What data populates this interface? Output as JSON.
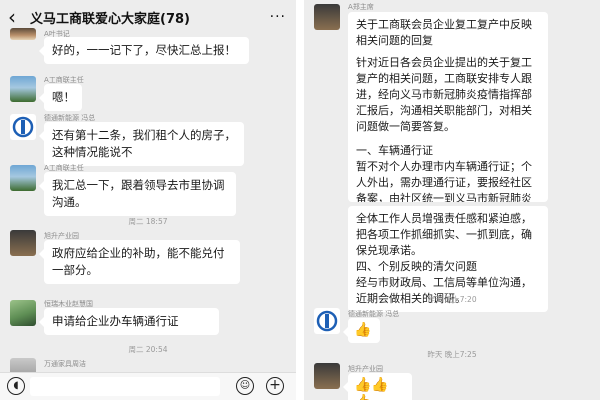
{
  "left": {
    "header": {
      "title": "义马工商联爱心大家庭(78)",
      "more": "···"
    },
    "names": {
      "top_cut": "A叶书记",
      "a_chairman": "A工商联主任",
      "dexin": "德通新能源 冯总",
      "a_chairman2": "A工商联主任",
      "xusheng": "旭升产业园",
      "hengrui": "恒瑞木业赵慧国",
      "wantong": "万通家具周洁"
    },
    "messages": {
      "m1": "好的，一一记下了，尽快汇总上报！",
      "m2": "嗯！",
      "m3": "还有第十二条，我们租个人的房子，这种情况能说不",
      "m4": "我汇总一下，跟着领导去市里协调沟通。",
      "m5": "政府应给企业的补助，能不能兑付一部分。",
      "m6": "申请给企业办车辆通行证"
    },
    "times": {
      "t1": "周二 18:57",
      "t2": "周二 20:54"
    }
  },
  "right": {
    "names": {
      "top": "A郑主席",
      "dexin": "德通新能源 冯总",
      "xusheng": "旭升产业园"
    },
    "doc": {
      "title": "关于工商联会员企业复工复产中反映相关问题的回复",
      "intro": "针对近日各会员企业提出的关于复工复产的相关问题，工商联安排专人跟进，经向义马市新冠肺炎疫情指挥部汇报后，沟通相关职能部门，对相关问题做一简要答复。",
      "section1": "一、车辆通行证",
      "section1_body": "暂不对个人办理市内车辆通行证；个人外出，需办理通行证，要报经社区备案，由社区统一到义马市新冠肺炎疫情防控指挥部办",
      "cont": "全体工作人员增强责任感和紧迫感，把各项工作抓细抓实、一抓到底，确保兑现承诺。",
      "section4": "四、个别反映的清欠问题",
      "section4_body": "经与市财政局、工信局等单位沟通，近期会做相关的调研。"
    },
    "times": {
      "t1": "昨天 晚上7:20",
      "t2": "昨天 晚上7:25"
    },
    "reactions": {
      "r1": "👍",
      "r2": "👍👍👍"
    }
  },
  "icons": {
    "voice": "voice-icon",
    "emoji": "emoji-icon",
    "plus": "plus-icon",
    "back": "back-arrow-icon"
  }
}
